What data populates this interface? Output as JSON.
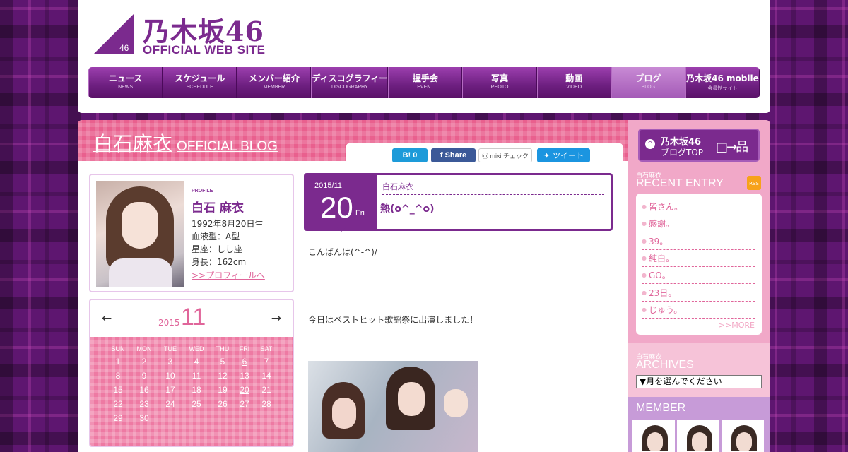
{
  "header": {
    "logo_num": "46",
    "logo_jp": "乃木坂46",
    "logo_en": "OFFICIAL WEB SITE"
  },
  "nav": [
    {
      "jp": "ニュース",
      "en": "NEWS"
    },
    {
      "jp": "スケジュール",
      "en": "SCHEDULE"
    },
    {
      "jp": "メンバー紹介",
      "en": "MEMBER"
    },
    {
      "jp": "ディスコグラフィー",
      "en": "DISCOGRAPHY"
    },
    {
      "jp": "握手会",
      "en": "EVENT"
    },
    {
      "jp": "写真",
      "en": "PHOTO"
    },
    {
      "jp": "動画",
      "en": "VIDEO"
    },
    {
      "jp": "ブログ",
      "en": "BLOG"
    },
    {
      "jp": "乃木坂46 mobile",
      "en": "会員制サイト"
    }
  ],
  "blog": {
    "name": "白石麻衣",
    "suffix": "OFFICIAL BLOG"
  },
  "share": {
    "hatena": "B! 0",
    "facebook": "f Share",
    "mixi": "ⓜ mixi チェック",
    "twitter": "ツイート"
  },
  "profile": {
    "label": "PROFILE",
    "name": "白石 麻衣",
    "birth": "1992年8月20日生",
    "blood": "血液型：A型",
    "sign": "星座：しし座",
    "height": "身長：162cm",
    "link": ">>プロフィールへ"
  },
  "calendar": {
    "prev": "←",
    "next": "→",
    "year": "2015",
    "month": "11",
    "dow": [
      "SUN",
      "MON",
      "TUE",
      "WED",
      "THU",
      "FRI",
      "SAT"
    ],
    "weeks": [
      [
        "1",
        "2",
        "3",
        "4",
        "5",
        "6",
        "7"
      ],
      [
        "8",
        "9",
        "10",
        "11",
        "12",
        "13",
        "14"
      ],
      [
        "15",
        "16",
        "17",
        "18",
        "19",
        "20",
        "21"
      ],
      [
        "22",
        "23",
        "24",
        "25",
        "26",
        "27",
        "28"
      ],
      [
        "29",
        "30",
        "",
        "",
        "",
        "",
        ""
      ]
    ]
  },
  "entry": {
    "year_month": "2015/11",
    "day": "20",
    "weekday": "Fri",
    "author": "白石麻衣",
    "title": "熱(o^_^o)",
    "text1": "こんばんは(^-^)/",
    "text2": "今日はベストヒット歌謡祭に出演しました！"
  },
  "sidebar": {
    "blog_top_line1": "乃木坂46",
    "blog_top_line2": "ブログTOP",
    "blog_top_arrow": "^",
    "blog_top_icon": "□→品",
    "recent_small": "白石麻衣",
    "recent_title": "RECENT ENTRY",
    "rss": "RSS",
    "recent": [
      "皆さん。",
      "感謝。",
      "39。",
      "純白。",
      "GO。",
      "23日。",
      "じゅう。"
    ],
    "more": ">>MORE",
    "archives_small": "白石麻衣",
    "archives_title": "ARCHIVES",
    "archive_select": "▼月を選んでください",
    "member_title": "MEMBER"
  }
}
